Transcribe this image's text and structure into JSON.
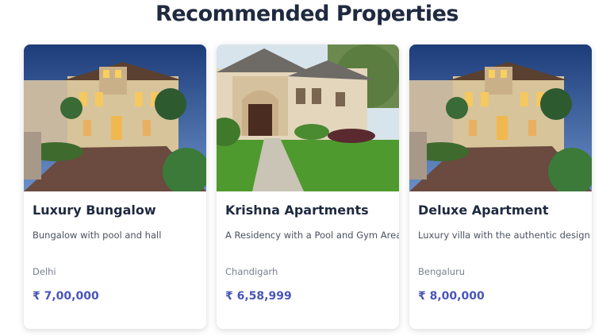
{
  "section": {
    "title": "Recommended Properties"
  },
  "properties": [
    {
      "name": "Luxury Bungalow",
      "description": "Bungalow with pool and hall",
      "city": "Delhi",
      "price": "₹ 7,00,000",
      "image": "villa-night-photo"
    },
    {
      "name": "Krishna Apartments",
      "description": "A Residency with a Pool and Gym Area",
      "city": "Chandigarh",
      "price": "₹ 6,58,999",
      "image": "house-day-photo"
    },
    {
      "name": "Deluxe Apartment",
      "description": "Luxury villa with the authentic design",
      "city": "Bengaluru",
      "price": "₹ 8,00,000",
      "image": "villa-night-photo"
    }
  ],
  "colors": {
    "title": "#1f2a40",
    "price": "#4a55b8",
    "card_bg": "#ffffff"
  }
}
